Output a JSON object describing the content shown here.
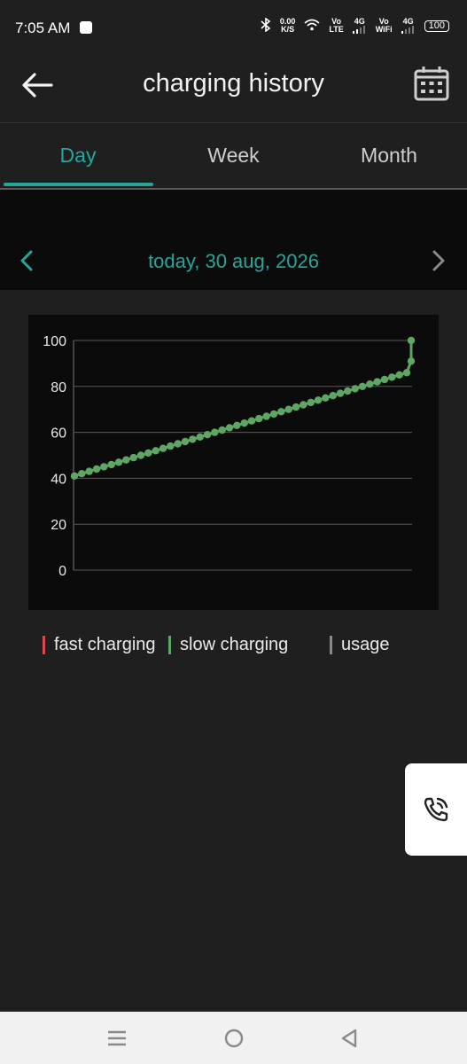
{
  "status_bar": {
    "time": "7:05 AM",
    "net_speed_value": "0.00",
    "net_speed_unit": "K/S",
    "volte_top": "Vo",
    "volte_bottom": "LTE",
    "sim1_gen": "4G",
    "vowifi_top": "Vo",
    "vowifi_bottom": "WiFi",
    "sim2_gen": "4G",
    "battery": "100"
  },
  "header": {
    "title": "charging history"
  },
  "tabs": [
    {
      "label": "Day",
      "active": true
    },
    {
      "label": "Week",
      "active": false
    },
    {
      "label": "Month",
      "active": false
    }
  ],
  "date_nav": {
    "label": "today, 30 aug, 2026"
  },
  "chart_data": {
    "type": "line",
    "y_ticks": [
      "100",
      "80",
      "60",
      "40",
      "20",
      "0"
    ],
    "ylim": [
      0,
      100
    ],
    "grid": true,
    "series": [
      {
        "color": "#5ea663",
        "values": [
          41,
          42,
          43,
          44,
          45,
          46,
          47,
          48,
          49,
          50,
          51,
          52,
          53,
          54,
          55,
          56,
          57,
          58,
          59,
          60,
          61,
          62,
          63,
          64,
          65,
          66,
          67,
          68,
          69,
          70,
          71,
          72,
          73,
          74,
          75,
          76,
          77,
          78,
          79,
          80,
          81,
          82,
          83,
          84,
          85,
          86,
          91,
          100
        ]
      }
    ]
  },
  "legend": [
    {
      "label": "fast charging",
      "color": "#e0454b"
    },
    {
      "label": "slow charging",
      "color": "#5ea663"
    },
    {
      "label": "usage",
      "color": "#8a8a8a"
    }
  ],
  "colors": {
    "accent": "#26a69a",
    "background": "#1f1f1f",
    "chart_bg": "#0b0b0b"
  }
}
